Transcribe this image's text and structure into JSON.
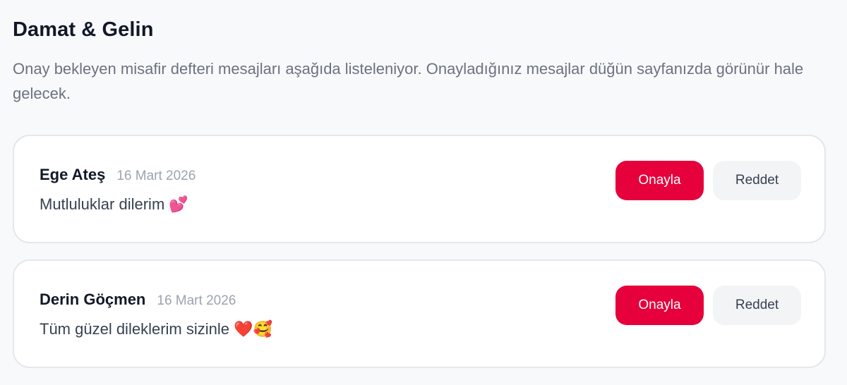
{
  "header": {
    "title": "Damat & Gelin",
    "description": "Onay bekleyen misafir defteri mesajları aşağıda listeleniyor. Onayladığınız mesajlar düğün sayfanızda görünür hale gelecek."
  },
  "messages": [
    {
      "name": "Ege Ateş",
      "date": "16 Mart 2026",
      "text": "Mutluluklar dilerim",
      "emoji": "💕",
      "approve_label": "Onayla",
      "reject_label": "Reddet"
    },
    {
      "name": "Derin Göçmen",
      "date": "16 Mart 2026",
      "text": "Tüm güzel dileklerim sizinle",
      "emoji": "❤️🥰",
      "approve_label": "Onayla",
      "reject_label": "Reddet"
    }
  ],
  "colors": {
    "accent": "#e6003c",
    "secondary_button": "#f3f4f6",
    "muted_text": "#6b7280",
    "date_text": "#9ca3af"
  },
  "icons": [
    "two-hearts-emoji",
    "red-heart-emoji",
    "smiling-face-with-hearts-emoji"
  ]
}
